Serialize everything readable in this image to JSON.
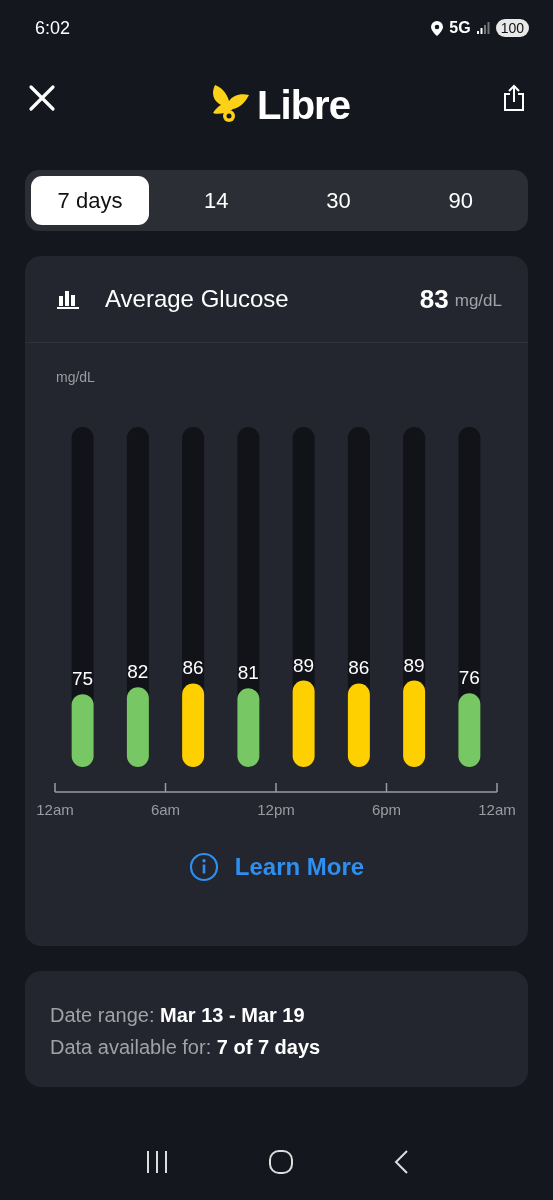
{
  "status_bar": {
    "time": "6:02",
    "network": "5G",
    "battery": "100"
  },
  "header": {
    "logo_text": "Libre"
  },
  "tabs": [
    {
      "label": "7 days",
      "selected": true
    },
    {
      "label": "14",
      "selected": false
    },
    {
      "label": "30",
      "selected": false
    },
    {
      "label": "90",
      "selected": false
    }
  ],
  "average_card": {
    "title": "Average Glucose",
    "value": "83",
    "unit": "mg/dL",
    "axis_unit": "mg/dL",
    "time_labels": [
      "12am",
      "6am",
      "12pm",
      "6pm",
      "12am"
    ],
    "chart_data": {
      "type": "bar",
      "ylim": [
        0,
        350
      ],
      "stacked": true,
      "data_labels": true,
      "series": [
        {
          "color": "#77c765",
          "values": [
            75,
            82,
            null,
            81,
            null,
            null,
            null,
            76
          ]
        },
        {
          "color": "#ffd000",
          "values": [
            null,
            null,
            86,
            null,
            89,
            86,
            89,
            null
          ]
        }
      ]
    },
    "link": "Learn More"
  },
  "info_card": {
    "lines": [
      "Date range:  **Mar 13 - Mar 19**",
      "Data available for: **7 of 7 days**"
    ]
  }
}
